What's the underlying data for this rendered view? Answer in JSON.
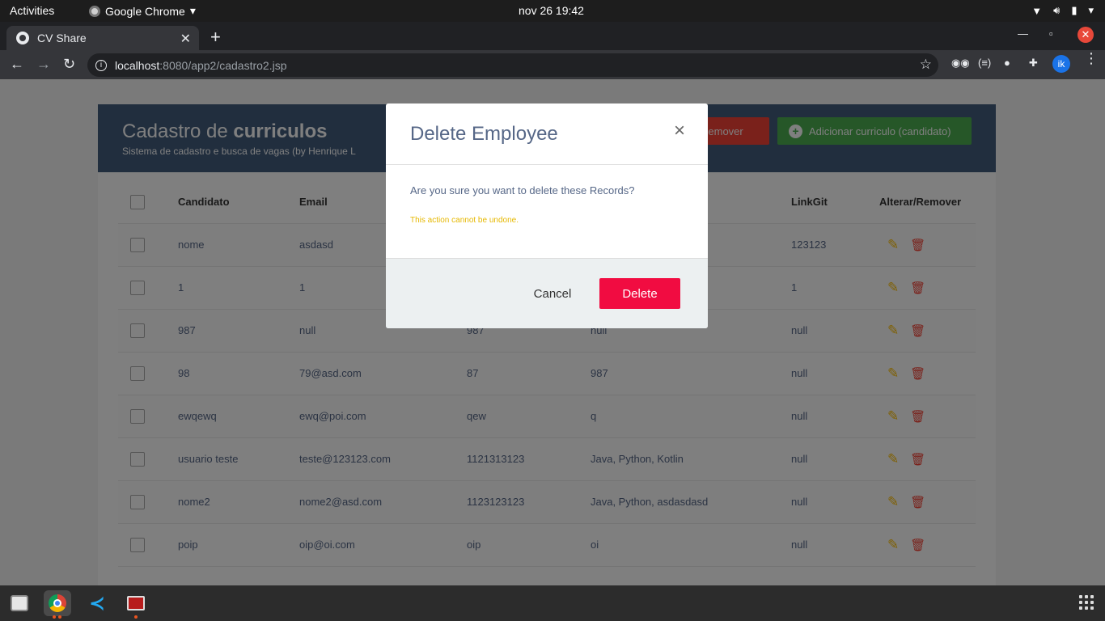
{
  "os": {
    "activities": "Activities",
    "app_name": "Google Chrome",
    "clock": "nov 26  19:42"
  },
  "browser": {
    "tab_title": "CV Share",
    "url_host": "localhost",
    "url_rest": ":8080/app2/cadastro2.jsp",
    "profile_initials": "ik"
  },
  "page": {
    "title_plain": "Cadastro de ",
    "title_bold": "curriculos",
    "subtitle": "Sistema de cadastro e busca de vagas (by Henrique L",
    "remove_label": "Remover",
    "add_label": "Adicionar curriculo (candidato)",
    "columns": [
      "Candidato",
      "Email",
      "",
      "",
      "LinkGit",
      "Alterar/Remover"
    ],
    "rows": [
      [
        "nome",
        "asdasd",
        "",
        "",
        "123123"
      ],
      [
        "1",
        "1",
        "",
        "",
        "1"
      ],
      [
        "987",
        "null",
        "987",
        "null",
        "null"
      ],
      [
        "98",
        "79@asd.com",
        "87",
        "987",
        "null"
      ],
      [
        "ewqewq",
        "ewq@poi.com",
        "qew",
        "q",
        "null"
      ],
      [
        "usuario teste",
        "teste@123123.com",
        "1121313123",
        "Java, Python, Kotlin",
        "null"
      ],
      [
        "nome2",
        "nome2@asd.com",
        "1123123123",
        "Java, Python, asdasdasd",
        "null"
      ],
      [
        "poip",
        "oip@oi.com",
        "oip",
        "oi",
        "null"
      ]
    ]
  },
  "modal": {
    "title": "Delete Employee",
    "close": "×",
    "message": "Are you sure you want to delete these Records?",
    "warning": "This action cannot be undone.",
    "cancel": "Cancel",
    "delete": "Delete"
  },
  "colors": {
    "header_bg": "#435d7d",
    "delete_red": "#f10c41",
    "add_green": "#4caf50",
    "warning_yellow": "#e6b800"
  }
}
